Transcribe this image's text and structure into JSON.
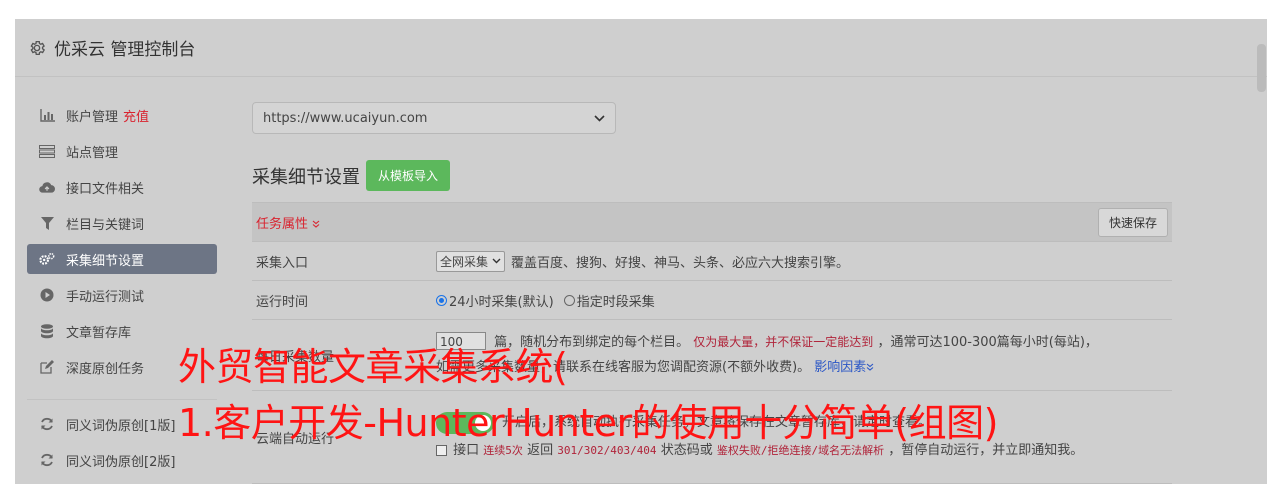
{
  "header": {
    "title": "优采云 管理控制台",
    "icon": "gear-icon"
  },
  "sidebar": {
    "items": [
      {
        "label": "账户管理",
        "badge": "充值",
        "icon": "bar-chart-icon"
      },
      {
        "label": "站点管理",
        "icon": "server-icon"
      },
      {
        "label": "接口文件相关",
        "icon": "cloud-upload-icon"
      },
      {
        "label": "栏目与关键词",
        "icon": "filter-icon"
      },
      {
        "label": "采集细节设置",
        "icon": "gears-icon",
        "active": true
      },
      {
        "label": "手动运行测试",
        "icon": "play-icon"
      },
      {
        "label": "文章暂存库",
        "icon": "database-icon"
      },
      {
        "label": "深度原创任务",
        "icon": "edit-icon"
      }
    ],
    "items2": [
      {
        "label": "同义词伪原创[1版]",
        "icon": "refresh-icon"
      },
      {
        "label": "同义词伪原创[2版]",
        "icon": "refresh-icon"
      }
    ]
  },
  "site_select": {
    "value": "https://www.ucaiyun.com"
  },
  "section": {
    "title": "采集细节设置",
    "import_button": "从模板导入"
  },
  "table": {
    "task_attr": "任务属性",
    "save_button": "快速保存",
    "rows": {
      "entry": {
        "label": "采集入口",
        "select_value": "全网采集",
        "desc": "覆盖百度、搜狗、好搜、神马、头条、必应六大搜索引擎。"
      },
      "time": {
        "label": "运行时间",
        "option1": "24小时采集(默认)",
        "option2": "指定时段采集"
      },
      "count": {
        "label": "每日采集数量",
        "value": "100",
        "text1": "篇，随机分布到绑定的每个栏目。",
        "highlight": "仅为最大量，并不保证一定能达到",
        "text2": "，通常可达100-300篇每小时(每站)，",
        "line2a": "如需更多采集数量，请联系在线客服为您调配资源(不额外收费)。",
        "link": "影响因素"
      },
      "auto": {
        "label": "云端自动运行",
        "text": "开启后，系统自动执行采集任务，文章将保存在文章暂存库，请定时查看。",
        "check_label": "接口",
        "red1": "连续5次",
        "t1": "返回",
        "codes": "301/302/403/404",
        "t2": "状态码或",
        "red2": "鉴权失败/拒绝连接/域名无法解析",
        "t3": "，暂停自动运行，并立即通知我。"
      }
    }
  },
  "overlay": {
    "line1": "外贸智能文章采集系统(",
    "line2": "1.客户开发-HunterHunter的使用十分简单(组图)"
  },
  "colors": {
    "accent_red": "#d9232f",
    "green": "#5cb85c",
    "active_nav": "#6d7585",
    "caption": "#ff1414"
  }
}
